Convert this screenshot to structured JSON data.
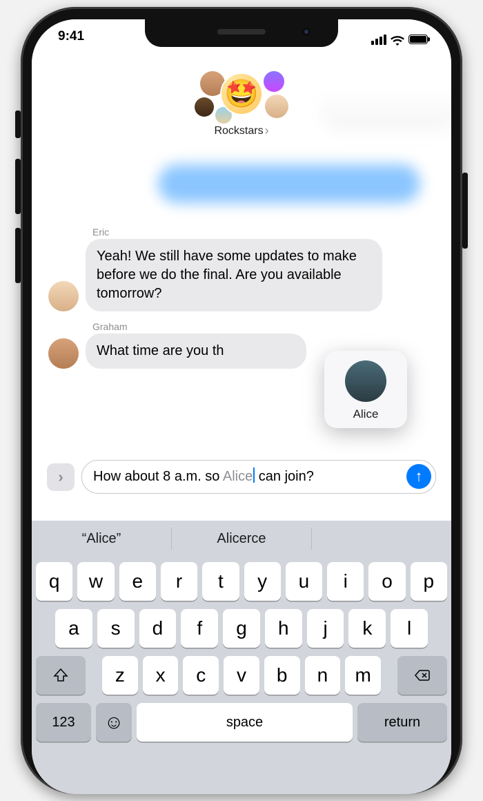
{
  "status": {
    "time": "9:41"
  },
  "header": {
    "group_name": "Rockstars",
    "chevron": "›",
    "main_emoji": "🤩"
  },
  "messages": [
    {
      "sender": "Eric",
      "text": "Yeah! We still have some updates to make before we do the final. Are you available tomorrow?"
    },
    {
      "sender": "Graham",
      "text": "What time are you th"
    }
  ],
  "mention": {
    "name": "Alice"
  },
  "compose": {
    "expand_glyph": "›",
    "text_before": "How about 8 a.m. so ",
    "mention_text": "Alice",
    "text_after": " can join?",
    "send_glyph": "↑"
  },
  "predictions": {
    "a": "“Alice”",
    "b": "Alicerce"
  },
  "keyboard": {
    "row1": [
      "q",
      "w",
      "e",
      "r",
      "t",
      "y",
      "u",
      "i",
      "o",
      "p"
    ],
    "row2": [
      "a",
      "s",
      "d",
      "f",
      "g",
      "h",
      "j",
      "k",
      "l"
    ],
    "row3": [
      "z",
      "x",
      "c",
      "v",
      "b",
      "n",
      "m"
    ],
    "num": "123",
    "emoji": "☺",
    "space": "space",
    "return": "return"
  }
}
